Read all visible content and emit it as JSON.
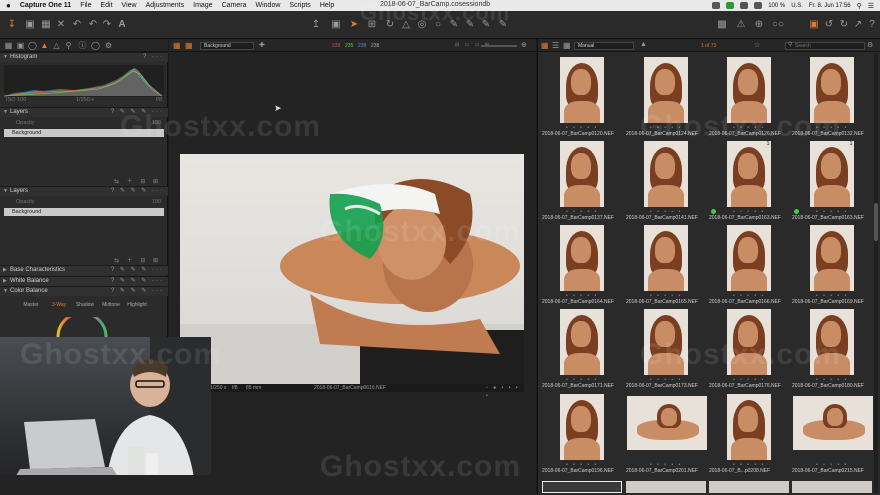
{
  "menubar": {
    "app": "Capture One 11",
    "items": [
      "File",
      "Edit",
      "View",
      "Adjustments",
      "Image",
      "Camera",
      "Window",
      "Scripts",
      "Help"
    ],
    "document": "2018-06-07_BarCamp.cosessiondb",
    "battery": "100 %",
    "locale": "U.S.",
    "clock": "Fr. 8. Jun 17:56"
  },
  "viewer": {
    "variant": "Background",
    "readout": {
      "r": "239",
      "g": "235",
      "b": "238",
      "l": "238"
    },
    "exposure": "1/250 s",
    "aperture": "f/8",
    "focal": "85 mm",
    "filename": "2018-06-07_BarCamp0616.NEF"
  },
  "left_panel": {
    "histogram": {
      "title": "Histogram",
      "iso": "ISO 100",
      "shutter": "1/250 s",
      "fstop": "f/8"
    },
    "layers1": {
      "title": "Layers",
      "opacity_label": "Opacity",
      "opacity_value": "100",
      "layer": "Background"
    },
    "layers2": {
      "title": "Layers",
      "opacity_label": "Opacity",
      "opacity_value": "100",
      "layer": "Background"
    },
    "base_characteristics": "Base Characteristics",
    "white_balance": "White Balance",
    "color_balance": "Color Balance",
    "cb_tabs": [
      "Master",
      "3-Way",
      "Shadow",
      "Midtone",
      "Highlight"
    ]
  },
  "browser": {
    "sort": "Manual",
    "count": "1 of 73",
    "search_placeholder": "Search",
    "thumbnails": [
      {
        "name": "2018-06-07_BarCamp0120.NEF",
        "col": 0,
        "row": 0,
        "pose": "head"
      },
      {
        "name": "2018-06-07_BarCamp0124.NEF",
        "col": 1,
        "row": 0,
        "pose": "head"
      },
      {
        "name": "2018-06-07_BarCamp0126.NEF",
        "col": 2,
        "row": 0,
        "pose": "head"
      },
      {
        "name": "2018-06-07_BarCamp0132.NEF",
        "col": 3,
        "row": 0,
        "pose": "head"
      },
      {
        "name": "2018-06-07_BarCamp0137.NEF",
        "col": 0,
        "row": 1,
        "pose": "head"
      },
      {
        "name": "2018-06-07_BarCamp0141.NEF",
        "col": 1,
        "row": 1,
        "pose": "head"
      },
      {
        "name": "2018-06-07_BarCamp0163.NEF",
        "col": 2,
        "row": 1,
        "pose": "head",
        "badge": "1",
        "green": true
      },
      {
        "name": "2018-06-07_BarCamp0163.NEF",
        "col": 3,
        "row": 1,
        "pose": "head",
        "badge": "1",
        "green": true
      },
      {
        "name": "2018-06-07_BarCamp0164.NEF",
        "col": 0,
        "row": 2,
        "pose": "head"
      },
      {
        "name": "2018-06-07_BarCamp0165.NEF",
        "col": 1,
        "row": 2,
        "pose": "head"
      },
      {
        "name": "2018-06-07_BarCamp0166.NEF",
        "col": 2,
        "row": 2,
        "pose": "head"
      },
      {
        "name": "2018-06-07_BarCamp0169.NEF",
        "col": 3,
        "row": 2,
        "pose": "head"
      },
      {
        "name": "2018-06-07_BarCamp0171.NEF",
        "col": 0,
        "row": 3,
        "pose": "head"
      },
      {
        "name": "2018-06-07_BarCamp0173.NEF",
        "col": 1,
        "row": 3,
        "pose": "head"
      },
      {
        "name": "2018-06-07_BarCamp0176.NEF",
        "col": 2,
        "row": 3,
        "pose": "head"
      },
      {
        "name": "2018-06-07_BarCamp0180.NEF",
        "col": 3,
        "row": 3,
        "pose": "head"
      },
      {
        "name": "2018-06-07_BarCamp0196.NEF",
        "col": 0,
        "row": 4,
        "pose": "head"
      },
      {
        "name": "2018-06-07_BarCamp0201.NEF",
        "col": 1,
        "row": 4,
        "pose": "lying"
      },
      {
        "name": "2018-06-07_B...p0208.NEF",
        "col": 2,
        "row": 4,
        "pose": "head"
      },
      {
        "name": "2018-06-07_BarCamp0215.NEF",
        "col": 3,
        "row": 4,
        "pose": "lying"
      }
    ]
  },
  "watermark": "Ghostxx.com",
  "colors": {
    "accent": "#e07a2c",
    "label_green": "#3bd13b",
    "panel": "#2b2b2b"
  }
}
